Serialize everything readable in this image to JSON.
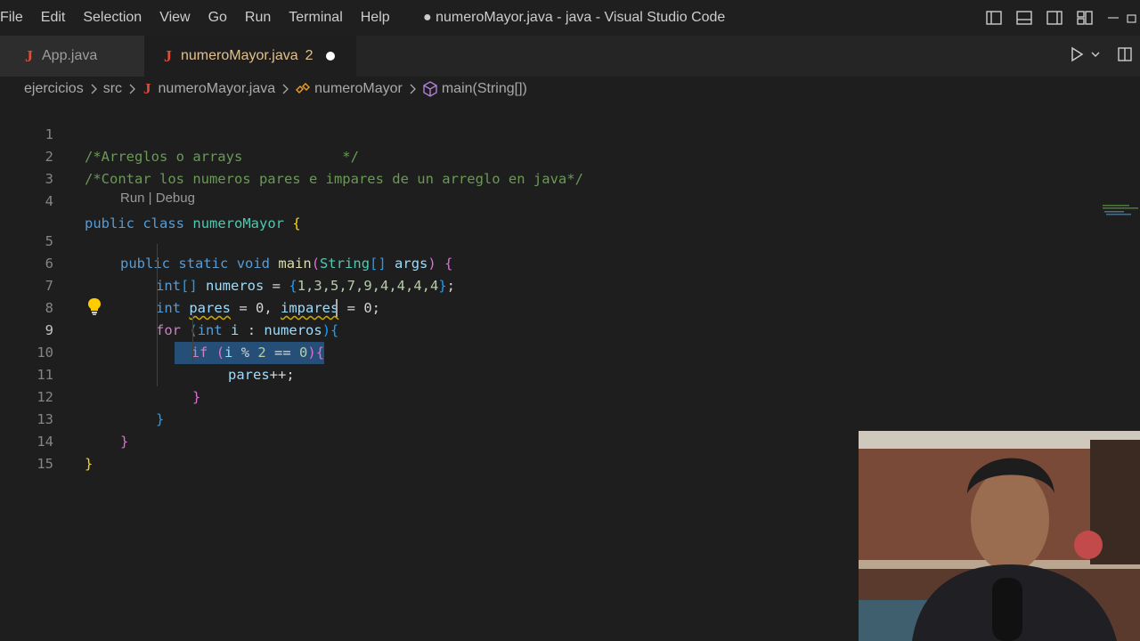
{
  "menu": [
    "File",
    "Edit",
    "Selection",
    "View",
    "Go",
    "Run",
    "Terminal",
    "Help"
  ],
  "window_title": "● numeroMayor.java - java - Visual Studio Code",
  "tabs": [
    {
      "label": "App.java",
      "icon": "java-file-icon"
    },
    {
      "label": "numeroMayor.java",
      "badge": "2",
      "icon": "java-file-icon",
      "modified": true
    }
  ],
  "breadcrumb": {
    "folder1": "ejercicios",
    "folder2": "src",
    "file": "numeroMayor.java",
    "class": "numeroMayor",
    "method": "main(String[])"
  },
  "codelens": "Run | Debug",
  "line_numbers": [
    "1",
    "2",
    "3",
    "4",
    "5",
    "6",
    "7",
    "8",
    "9",
    "10",
    "11",
    "12",
    "13",
    "14",
    "15"
  ],
  "code": {
    "l1": "/*Arreglos o arrays            */",
    "l2": "/*Contar los numeros pares e impares de un arreglo en java*/",
    "l4": {
      "public": "public",
      "class": "class",
      "name": "numeroMayor",
      "brace": "{"
    },
    "l5": {
      "public": "public",
      "static": "static",
      "void": "void",
      "main": "main",
      "paren_open": "(",
      "String": "String",
      "brackets": "[]",
      "args": "args",
      "paren_close": ")",
      "brace": "{"
    },
    "l6": {
      "int": "int",
      "brackets": "[]",
      "name": "numeros",
      "eq": " = ",
      "open": "{",
      "values": "1,3,5,7,9,4,4,4,4",
      "close": "}",
      "semi": ";"
    },
    "l7": {
      "int": "int",
      "pares": "pares",
      "mid": " = 0, ",
      "impares": "impares",
      "end": " = 0;"
    },
    "l8": {
      "for": "for",
      "open": "(",
      "int": "int",
      "i": "i",
      "colon": " : ",
      "numeros": "numeros",
      "close": ")",
      "brace": "{"
    },
    "l9": {
      "if": "if",
      "open": "(",
      "i": "i",
      "mod": " % ",
      "two": "2",
      "eqeq": " == ",
      "zero": "0",
      "close": ")",
      "brace": "{"
    },
    "l10": {
      "pares": "pares",
      "inc": "++;"
    },
    "l11": "}",
    "l12": "}",
    "l13": "}",
    "l14": "}"
  },
  "colors": {
    "background": "#1e1e1e",
    "selection": "#264f78",
    "comment": "#6a9955",
    "keyword": "#569cd6"
  }
}
